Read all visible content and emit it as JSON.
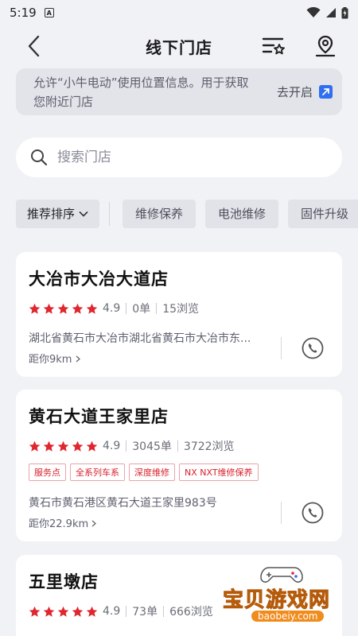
{
  "status_bar": {
    "time": "5:19",
    "a_icon_letter": "A"
  },
  "header": {
    "title": "线下门店"
  },
  "permission": {
    "text": "允许“小牛电动”使用位置信息。用于获取您附近门店",
    "action": "去开启"
  },
  "search": {
    "placeholder": "搜索门店"
  },
  "filters": {
    "sort": "推荐排序",
    "chips": [
      "维修保养",
      "电池维修",
      "固件升级"
    ]
  },
  "stores": [
    {
      "name": "大冶市大冶大道店",
      "rating": "4.9",
      "orders": "0单",
      "views": "15浏览",
      "tags": [],
      "address": "湖北省黄石市大冶市湖北省黄石市大冶市东...",
      "distance": "距你9km"
    },
    {
      "name": "黄石大道王家里店",
      "rating": "4.9",
      "orders": "3045单",
      "views": "3722浏览",
      "tags": [
        "服务点",
        "全系列车系",
        "深度维修",
        "NX NXT维修保养"
      ],
      "address": "黄石市黄石港区黄石大道王家里983号",
      "distance": "距你22.9km"
    },
    {
      "name": "五里墩店",
      "rating": "4.9",
      "orders": "73单",
      "views": "666浏览",
      "tags": [],
      "address": "",
      "distance": ""
    }
  ],
  "watermark": {
    "text": "宝贝游戏网",
    "url": "baobeiy.com"
  },
  "colors": {
    "accent": "#2f6ff0",
    "star": "#e0262f",
    "tag": "#d8202b",
    "background": "#f1f2f6"
  }
}
